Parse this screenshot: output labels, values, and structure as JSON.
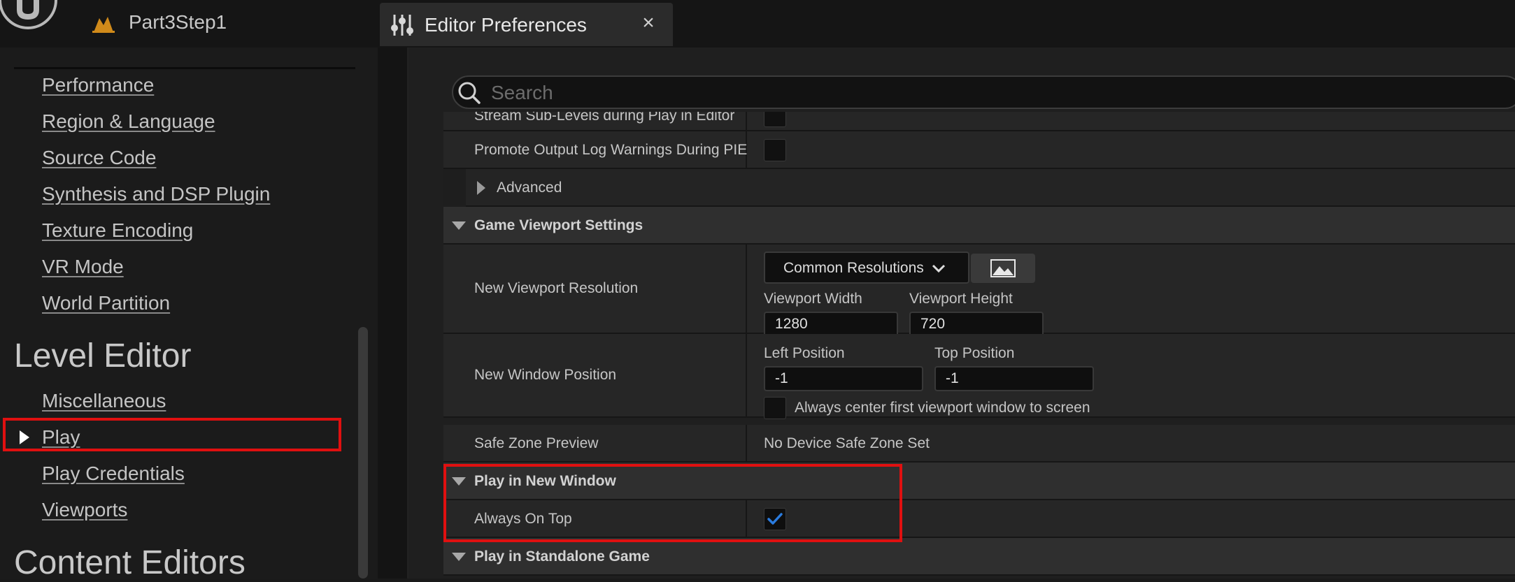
{
  "titlebar": {
    "project_name": "Part3Step1",
    "tab_title": "Editor Preferences",
    "tab_close_glyph": "×"
  },
  "sidebar": {
    "items_top": [
      {
        "label": "Performance"
      },
      {
        "label": "Region & Language"
      },
      {
        "label": "Source Code"
      },
      {
        "label": "Synthesis and DSP Plugin"
      },
      {
        "label": "Texture Encoding"
      },
      {
        "label": "VR Mode"
      },
      {
        "label": "World Partition"
      }
    ],
    "section_level_editor": "Level Editor",
    "items_level_editor": [
      {
        "label": "Miscellaneous"
      },
      {
        "label": "Play",
        "selected": true
      },
      {
        "label": "Play Credentials"
      },
      {
        "label": "Viewports"
      }
    ],
    "section_content_editors": "Content Editors"
  },
  "search": {
    "placeholder": "Search"
  },
  "details": {
    "rows": {
      "stream_sublevels": "Stream Sub-Levels during Play in Editor",
      "promote_warnings": "Promote Output Log Warnings During PIE",
      "advanced": "Advanced"
    },
    "game_viewport": {
      "header": "Game Viewport Settings",
      "new_viewport_resolution": "New Viewport Resolution",
      "dropdown_label": "Common Resolutions",
      "viewport_width_label": "Viewport Width",
      "viewport_width": "1280",
      "viewport_height_label": "Viewport Height",
      "viewport_height": "720",
      "new_window_position": "New Window Position",
      "left_position_label": "Left Position",
      "left_position": "-1",
      "top_position_label": "Top Position",
      "top_position": "-1",
      "always_center_label": "Always center first viewport window to screen",
      "safe_zone_label": "Safe Zone Preview",
      "safe_zone_value": "No Device Safe Zone Set"
    },
    "play_in_new_window": {
      "header": "Play in New Window",
      "always_on_top_label": "Always On Top",
      "always_on_top": true
    },
    "play_standalone": {
      "header": "Play in Standalone Game"
    }
  },
  "colors": {
    "accent_checkbox": "#2a7bde",
    "highlight_red": "#e01010",
    "ue_logo": "#b8b8b8",
    "project_icon": "#d08a1a"
  }
}
